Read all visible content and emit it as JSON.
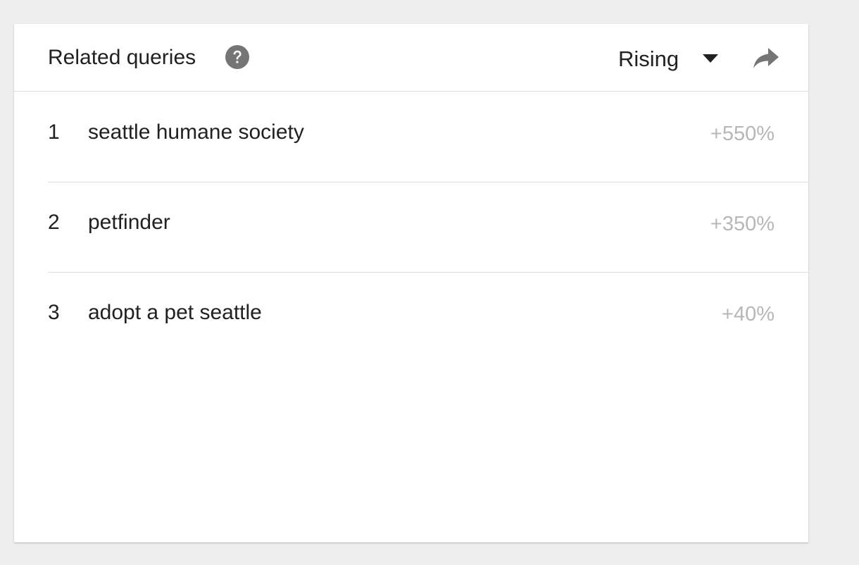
{
  "card": {
    "title": "Related queries",
    "help_icon": "help-circle-icon",
    "dropdown": {
      "selected": "Rising",
      "caret_icon": "caret-down-icon"
    },
    "share_icon": "share-icon"
  },
  "queries": [
    {
      "rank": "1",
      "label": "seattle humane society",
      "value": "+550%"
    },
    {
      "rank": "2",
      "label": "petfinder",
      "value": "+350%"
    },
    {
      "rank": "3",
      "label": "adopt a pet seattle",
      "value": "+40%"
    }
  ],
  "colors": {
    "background": "#eeeeee",
    "card": "#ffffff",
    "text": "#212121",
    "muted_value": "#b7b7b7",
    "icon": "#757575",
    "divider": "#dcdcdc"
  }
}
